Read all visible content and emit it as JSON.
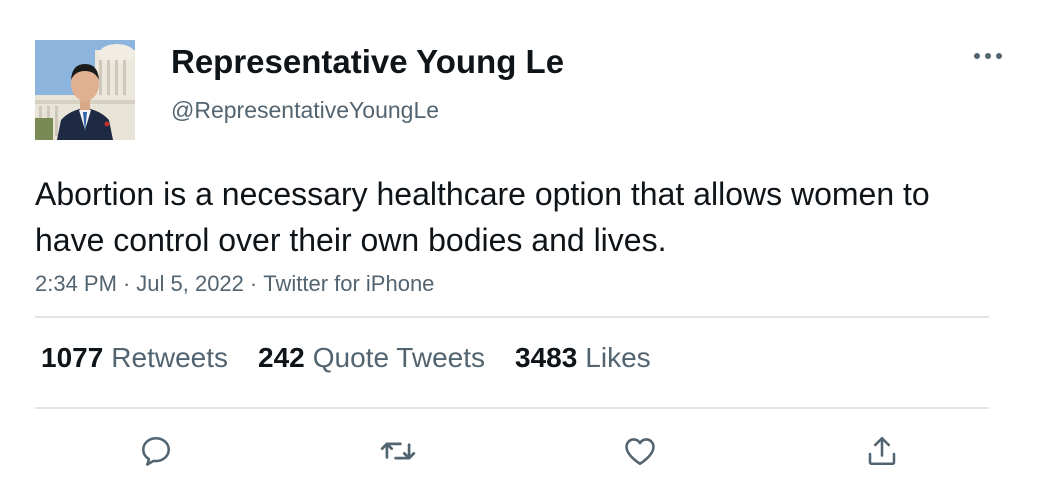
{
  "user": {
    "display_name": "Representative Young Le",
    "handle": "@RepresentativeYoungLe"
  },
  "tweet": {
    "text": "Abortion is a necessary healthcare option that allows women to have control over their own bodies and lives.",
    "time": "2:34 PM",
    "date": "Jul 5, 2022",
    "source": "Twitter for iPhone",
    "separator": "·"
  },
  "stats": {
    "retweets_count": "1077",
    "retweets_label": "Retweets",
    "quote_count": "242",
    "quote_label": "Quote Tweets",
    "likes_count": "3483",
    "likes_label": "Likes"
  },
  "icons": {
    "more": "more-horizontal-icon",
    "reply": "reply-icon",
    "retweet": "retweet-icon",
    "like": "heart-icon",
    "share": "share-icon"
  },
  "colors": {
    "text_primary": "#0f1419",
    "text_secondary": "#536471",
    "divider": "#e3e6e8",
    "icon": "#536471"
  }
}
